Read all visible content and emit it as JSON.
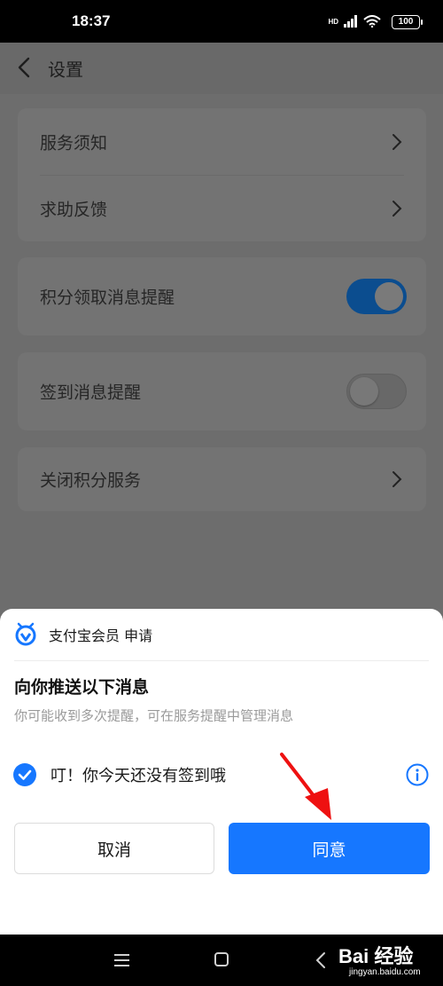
{
  "status_bar": {
    "time": "18:37",
    "battery": "100",
    "network": "HD"
  },
  "header": {
    "title": "设置"
  },
  "settings": {
    "items": [
      {
        "label": "服务须知"
      },
      {
        "label": "求助反馈"
      },
      {
        "label": "积分领取消息提醒",
        "toggle_on": true
      },
      {
        "label": "签到消息提醒",
        "toggle_on": false
      },
      {
        "label": "关闭积分服务"
      }
    ]
  },
  "sheet": {
    "app_name": "支付宝会员 申请",
    "title": "向你推送以下消息",
    "subtitle": "你可能收到多次提醒，可在服务提醒中管理消息",
    "message": "叮！你今天还没有签到哦",
    "message_checked": true,
    "cancel_label": "取消",
    "agree_label": "同意"
  },
  "watermark": {
    "brand": "Bai 经验",
    "url": "jingyan.baidu.com"
  },
  "colors": {
    "accent": "#1677ff",
    "toggle_on_dimmed": "#0b4d8f",
    "overlay_bg": "#6e6e6e"
  },
  "icons": {
    "back": "chevron-left-icon",
    "row": "chevron-right-icon",
    "check": "check-icon",
    "info": "info-icon",
    "logo": "alipay-member-logo",
    "arrow": "red-arrow-annotation"
  }
}
